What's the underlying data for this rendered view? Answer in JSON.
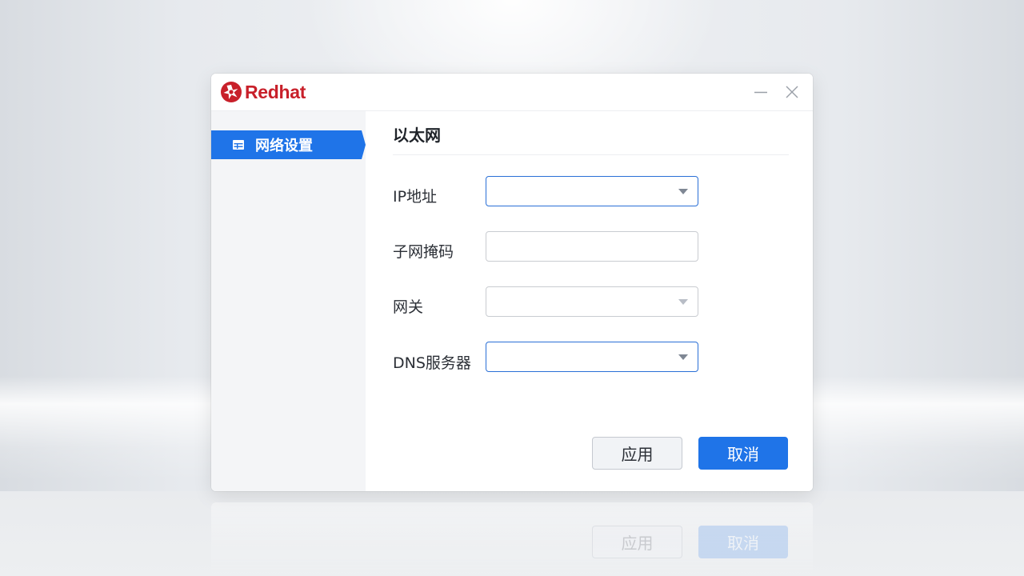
{
  "app": {
    "brand": "Redhat"
  },
  "window_controls": {
    "minimize_icon": "minimize-icon",
    "close_icon": "close-icon"
  },
  "sidebar": {
    "items": [
      {
        "label": "网络设置",
        "icon": "table-icon",
        "selected": true
      }
    ]
  },
  "main": {
    "section_title": "以太网",
    "fields": [
      {
        "label": "IP地址",
        "value": "",
        "type": "dropdown",
        "focused": true
      },
      {
        "label": "子网掩码",
        "value": "",
        "type": "text",
        "focused": false
      },
      {
        "label": "网关",
        "value": "",
        "type": "dropdown",
        "focused": false
      },
      {
        "label": "DNS服务器",
        "value": "",
        "type": "dropdown",
        "focused": true
      }
    ]
  },
  "buttons": {
    "apply": "应用",
    "cancel": "取消"
  },
  "colors": {
    "accent": "#1f74e8",
    "brand": "#c8202a"
  }
}
